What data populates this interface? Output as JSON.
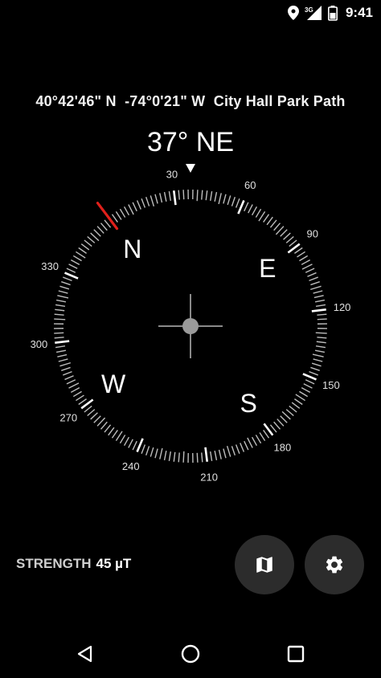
{
  "status_bar": {
    "time": "9:41",
    "network_label": "3G",
    "icons": [
      "location-pin-icon",
      "signal-icon",
      "battery-icon"
    ]
  },
  "location": {
    "latitude": "40°42'46\" N",
    "longitude": "-74°0'21\" W",
    "place": "City Hall Park Path"
  },
  "heading": {
    "degrees": 37,
    "text": "37° NE"
  },
  "compass": {
    "cardinals": [
      "N",
      "E",
      "S",
      "W"
    ],
    "degree_labels": [
      "30",
      "60",
      "90",
      "120",
      "150",
      "180",
      "210",
      "240",
      "270",
      "300",
      "330"
    ],
    "needle_color": "#e0201b"
  },
  "strength": {
    "label": "STRENGTH",
    "value": "45 µT"
  },
  "actions": {
    "map_icon": "map-icon",
    "settings_icon": "gear-icon"
  },
  "navigation": {
    "icons": [
      "back-icon",
      "home-icon",
      "recents-icon"
    ]
  }
}
